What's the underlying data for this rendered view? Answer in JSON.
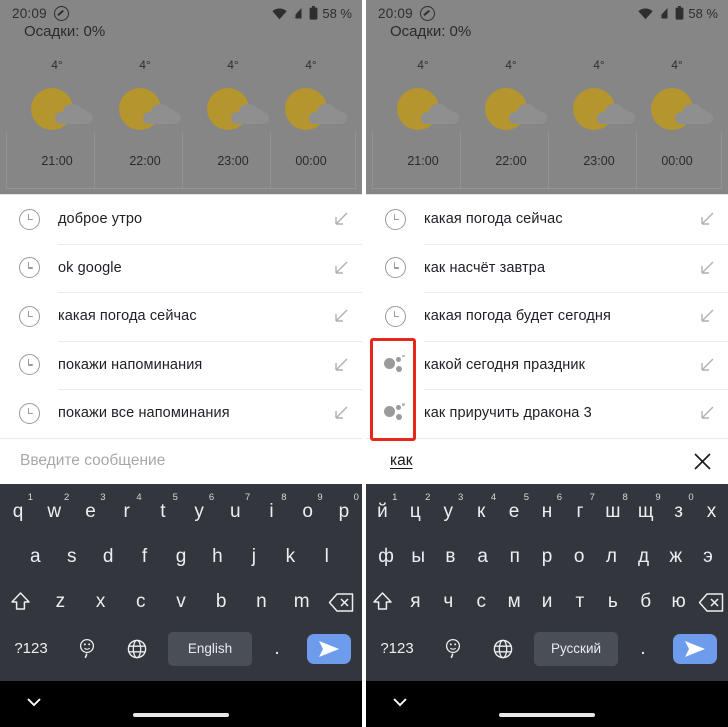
{
  "statusbar": {
    "time": "20:09",
    "battery": "58 %",
    "icons": [
      "dnd-icon",
      "wifi-icon",
      "cellular-off-icon",
      "battery-icon"
    ]
  },
  "weather": {
    "precipitation_label": "Осадки: 0%",
    "forecast": [
      {
        "temp": "4°",
        "time": "21:00",
        "condition": "partly-cloudy"
      },
      {
        "temp": "4°",
        "time": "22:00",
        "condition": "partly-cloudy"
      },
      {
        "temp": "4°",
        "time": "23:00",
        "condition": "partly-cloudy"
      },
      {
        "temp": "4°",
        "time": "00:00",
        "condition": "partly-cloudy"
      }
    ]
  },
  "left_panel": {
    "suggestions": [
      {
        "icon": "clock-icon",
        "label": "доброе утро",
        "action_icon": "arrow-down-left-icon"
      },
      {
        "icon": "clock-icon",
        "label": "ok google",
        "action_icon": "arrow-down-left-icon"
      },
      {
        "icon": "clock-icon",
        "label": "какая погода сейчас",
        "action_icon": "arrow-down-left-icon"
      },
      {
        "icon": "clock-icon",
        "label": "покажи напоминания",
        "action_icon": "arrow-down-left-icon"
      },
      {
        "icon": "clock-icon",
        "label": "покажи все напоминания",
        "action_icon": "arrow-down-left-icon"
      }
    ],
    "input": {
      "placeholder": "Введите сообщение",
      "value": ""
    },
    "keyboard": {
      "layout": "qwerty",
      "row1": [
        {
          "key": "q",
          "hint": "1"
        },
        {
          "key": "w",
          "hint": "2"
        },
        {
          "key": "e",
          "hint": "3"
        },
        {
          "key": "r",
          "hint": "4"
        },
        {
          "key": "t",
          "hint": "5"
        },
        {
          "key": "y",
          "hint": "6"
        },
        {
          "key": "u",
          "hint": "7"
        },
        {
          "key": "i",
          "hint": "8"
        },
        {
          "key": "o",
          "hint": "9"
        },
        {
          "key": "p",
          "hint": "0"
        }
      ],
      "row2": [
        "a",
        "s",
        "d",
        "f",
        "g",
        "h",
        "j",
        "k",
        "l"
      ],
      "row3": [
        "z",
        "x",
        "c",
        "v",
        "b",
        "n",
        "m"
      ],
      "symbols_key": "?123",
      "space_label": "English",
      "period_key": ".",
      "shift_icon": "shift-icon",
      "backspace_icon": "backspace-icon",
      "emoji_icon": "emoji-icon",
      "globe_icon": "globe-icon",
      "send_icon": "send-icon"
    }
  },
  "right_panel": {
    "suggestions": [
      {
        "icon": "clock-icon",
        "label": "какая погода сейчас",
        "action_icon": "arrow-down-left-icon"
      },
      {
        "icon": "clock-icon",
        "label": "как насчёт завтра",
        "action_icon": "arrow-down-left-icon"
      },
      {
        "icon": "clock-icon",
        "label": "какая погода будет сегодня",
        "action_icon": "arrow-down-left-icon"
      },
      {
        "icon": "search-dots-icon",
        "label": "какой сегодня праздник",
        "action_icon": "arrow-down-left-icon"
      },
      {
        "icon": "search-dots-icon",
        "label": "как приручить дракона 3",
        "action_icon": "arrow-down-left-icon"
      }
    ],
    "input": {
      "placeholder": "Введите сообщение",
      "value": "как",
      "clear_icon": "close-icon"
    },
    "annotation": {
      "color": "#e8271b",
      "target": "search-dots-icon-column"
    },
    "keyboard": {
      "layout": "йцукен",
      "row1": [
        {
          "key": "й",
          "hint": "1"
        },
        {
          "key": "ц",
          "hint": "2"
        },
        {
          "key": "у",
          "hint": "3"
        },
        {
          "key": "к",
          "hint": "4"
        },
        {
          "key": "е",
          "hint": "5"
        },
        {
          "key": "н",
          "hint": "6"
        },
        {
          "key": "г",
          "hint": "7"
        },
        {
          "key": "ш",
          "hint": "8"
        },
        {
          "key": "щ",
          "hint": "9"
        },
        {
          "key": "з",
          "hint": "0"
        },
        {
          "key": "х",
          "hint": ""
        }
      ],
      "row2": [
        "ф",
        "ы",
        "в",
        "а",
        "п",
        "р",
        "о",
        "л",
        "д",
        "ж",
        "э"
      ],
      "row3": [
        "я",
        "ч",
        "с",
        "м",
        "и",
        "т",
        "ь",
        "б",
        "ю"
      ],
      "symbols_key": "?123",
      "space_label": "Русский",
      "period_key": ".",
      "shift_icon": "shift-icon",
      "backspace_icon": "backspace-icon",
      "emoji_icon": "emoji-icon",
      "globe_icon": "globe-icon",
      "send_icon": "send-icon"
    }
  },
  "navbar": {
    "hide_keyboard_icon": "chevron-down-icon",
    "home_indicator": "home-pill"
  },
  "colors": {
    "accent_send": "#6e9ced",
    "keyboard_bg": "#33373d",
    "keyboard_space": "#4a4f57",
    "dimmed_app": "#868686",
    "sun": "#b5952e",
    "cloud": "#8f8f8f",
    "annotation": "#e8271b"
  }
}
